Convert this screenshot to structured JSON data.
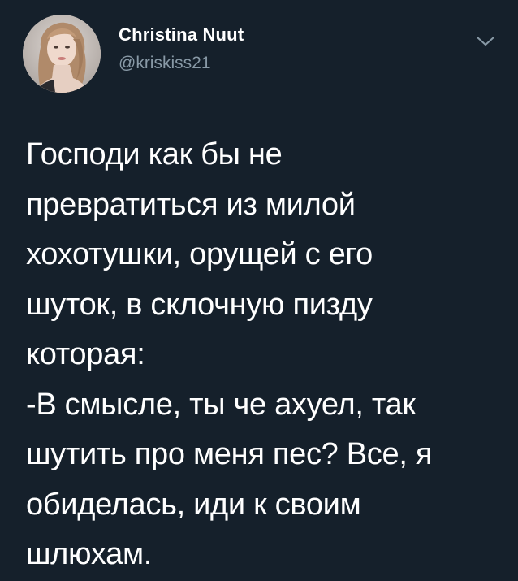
{
  "author": {
    "display_name": "Christina Nuut",
    "handle": "@kriskiss21",
    "avatar_icon": "profile-photo"
  },
  "menu": {
    "icon": "chevron-down-icon"
  },
  "tweet": {
    "lines": [
      "Господи как бы не",
      "превратиться из милой",
      "хохотушки, орущей с его",
      "шуток, в склочную пизду",
      "которая:",
      "-В смысле, ты че ахуел, так",
      "шутить про меня пес? Все, я",
      "обиделась, иди к своим",
      "шлюхам."
    ]
  },
  "colors": {
    "background": "#15202b",
    "text_primary": "#ffffff",
    "text_secondary": "#8899a6"
  }
}
